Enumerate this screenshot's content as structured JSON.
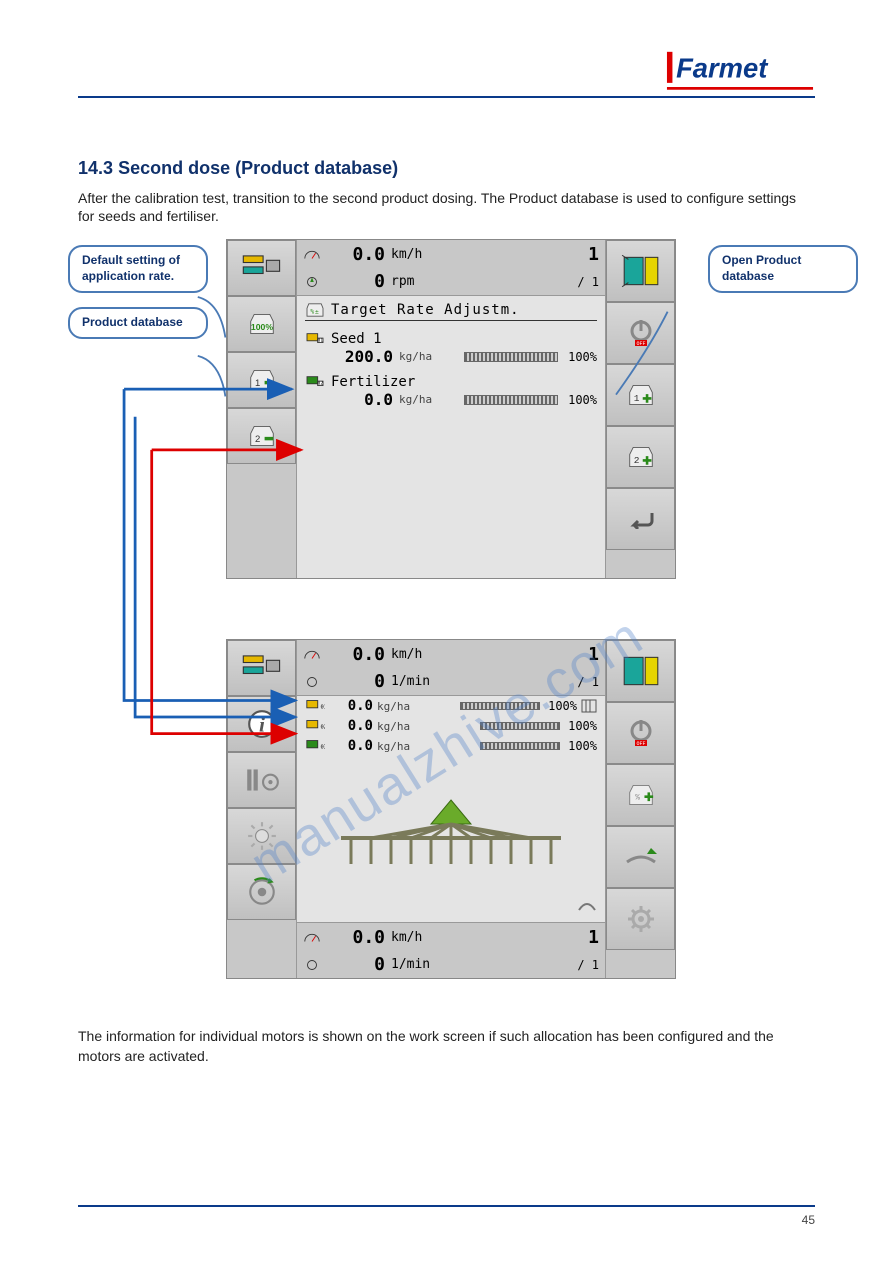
{
  "brand": "Farmet",
  "section_number": "14.3",
  "section_title": "Second dose (Product database)",
  "intro_text": "After the calibration test, transition to the second product dosing. The Product database is used to configure settings for seeds and fertiliser.",
  "callouts": {
    "c1": "Default setting of application rate.",
    "c2": "Product database",
    "c3": "Open Product database"
  },
  "post_text": "The information for individual motors is shown on the work screen if such allocation has been configured and the motors are activated.",
  "terminal1": {
    "status": {
      "speed_val": "0.0",
      "speed_unit": "km/h",
      "right_big": "1",
      "rpm_val": "0",
      "rpm_unit": "rpm",
      "right_small": "/ 1"
    },
    "title": "Target Rate Adjustm.",
    "products": [
      {
        "name": "Seed 1",
        "rate": "200.0",
        "unit": "kg/ha",
        "pct": "100%"
      },
      {
        "name": "Fertilizer",
        "rate": "0.0",
        "unit": "kg/ha",
        "pct": "100%"
      }
    ],
    "leftKeys": [
      "machine-icon",
      "bag-100-icon",
      "bag-1-minus-icon",
      "bag-2-minus-icon"
    ],
    "rightKeys": [
      "tile-icon",
      "power-off-icon",
      "bag-1-plus-icon",
      "bag-2-plus-icon",
      "return-icon"
    ]
  },
  "terminal2": {
    "status_top": {
      "speed_val": "0.0",
      "speed_unit": "km/h",
      "right_big": "1",
      "rpm_val": "0",
      "rpm_unit": "1/min",
      "right_small": "/ 1"
    },
    "rows": [
      {
        "rate": "0.0",
        "unit": "kg/ha",
        "pct": "100%"
      },
      {
        "rate": "0.0",
        "unit": "kg/ha",
        "pct": "100%"
      },
      {
        "rate": "0.0",
        "unit": "kg/ha",
        "pct": "100%"
      }
    ],
    "status_bot": {
      "speed_val": "0.0",
      "speed_unit": "km/h",
      "right_big": "1",
      "rpm_val": "0",
      "rpm_unit": "1/min",
      "right_small": "/ 1"
    },
    "leftKeys": [
      "machine-icon",
      "info-icon",
      "tramline-gear-icon",
      "light-icon",
      "wheel-icon"
    ],
    "rightKeys": [
      "tile-icon",
      "power-off-icon",
      "bag-pct-plus-icon",
      "implement-up-icon",
      "gear-icon"
    ]
  },
  "footer_left": "",
  "footer_right": "45",
  "colors": {
    "blue": "#0a3a8a",
    "green": "#3a9a1a",
    "red": "#d00"
  },
  "watermark": "manualzhive.com"
}
